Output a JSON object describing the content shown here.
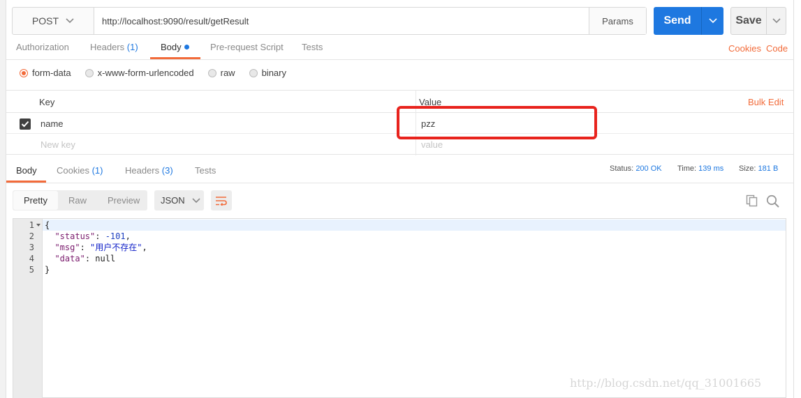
{
  "request": {
    "method": "POST",
    "url": "http://localhost:9090/result/getResult",
    "params_label": "Params",
    "send_label": "Send",
    "save_label": "Save"
  },
  "request_tabs": [
    {
      "label": "Authorization"
    },
    {
      "label": "Headers",
      "count": "(1)"
    },
    {
      "label": "Body"
    },
    {
      "label": "Pre-request Script"
    },
    {
      "label": "Tests"
    }
  ],
  "request_links": {
    "cookies": "Cookies",
    "code": "Code"
  },
  "body_types": [
    {
      "label": "form-data",
      "selected": true
    },
    {
      "label": "x-www-form-urlencoded",
      "selected": false
    },
    {
      "label": "raw",
      "selected": false
    },
    {
      "label": "binary",
      "selected": false
    }
  ],
  "form_table": {
    "key_header": "Key",
    "value_header": "Value",
    "bulk_edit": "Bulk Edit",
    "rows": [
      {
        "key": "name",
        "value": "pzz",
        "checked": true
      }
    ],
    "new_key_placeholder": "New key",
    "new_value_placeholder": "value"
  },
  "response_tabs": [
    {
      "label": "Body"
    },
    {
      "label": "Cookies",
      "count": "(1)"
    },
    {
      "label": "Headers",
      "count": "(3)"
    },
    {
      "label": "Tests"
    }
  ],
  "response_meta": {
    "status_label": "Status:",
    "status_value": "200 OK",
    "time_label": "Time:",
    "time_value": "139 ms",
    "size_label": "Size:",
    "size_value": "181 B"
  },
  "view_modes": [
    "Pretty",
    "Raw",
    "Preview"
  ],
  "format": "JSON",
  "code_lines": [
    "1",
    "2",
    "3",
    "4",
    "5"
  ],
  "response_body": {
    "open": "{",
    "status_key": "\"status\"",
    "status_val": "-101",
    "msg_key": "\"msg\"",
    "msg_val": "\"用户不存在\"",
    "data_key": "\"data\"",
    "data_val": "null",
    "close": "}"
  },
  "watermark": "http://blog.csdn.net/qq_31001665",
  "colors": {
    "accent": "#f26b3a",
    "send": "#1e78e0",
    "highlight": "#e8231d"
  }
}
